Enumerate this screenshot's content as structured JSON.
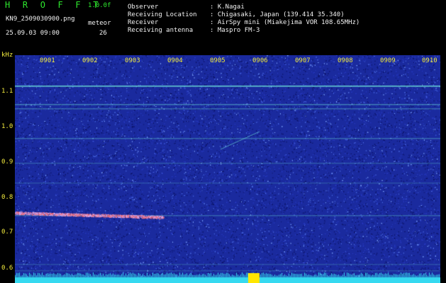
{
  "header": {
    "title": "H R O F F T",
    "version": "1.0.0f",
    "filename": "KN9_2509030900.png",
    "meteor_label": "meteor",
    "datetime": "25.09.03 09:00",
    "meteor_count": "26",
    "info": [
      {
        "key": "Observer",
        "value": ": K.Nagai"
      },
      {
        "key": "Receiving Location",
        "value": ": Chigasaki, Japan (139.414 35.340)"
      },
      {
        "key": "Receiver",
        "value": ": AirSpy mini (Miakejima VOR 108.65MHz)"
      },
      {
        "key": "Receiving antenna",
        "value": ": Maspro FM-3"
      }
    ]
  },
  "axes": {
    "y_unit": "kHz",
    "y_ticks": [
      "1.1",
      "1.0",
      "0.9",
      "0.8",
      "0.7",
      "0.6"
    ],
    "x_ticks": [
      "0901",
      "0902",
      "0903",
      "0904",
      "0905",
      "0906",
      "0907",
      "0908",
      "0909",
      "0910"
    ]
  },
  "colors": {
    "background": "#000000",
    "spectrum_base": "#1a2a9e",
    "carrier_line": "#6fe7d8",
    "meteor_echo": "#ff6b6b",
    "baseline_bar": "#35d9f0",
    "burst": "#ffe600",
    "label_green": "#2ee82e",
    "label_yellow": "#f4ec3e"
  }
}
